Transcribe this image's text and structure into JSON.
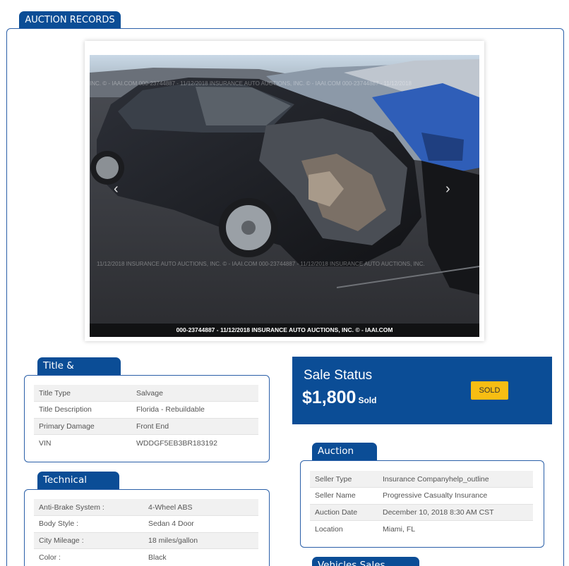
{
  "header": {
    "title": "AUCTION RECORDS"
  },
  "photo": {
    "caption": "000-23744887 - 11/12/2018 INSURANCE AUTO AUCTIONS, INC. © - IAAI.COM",
    "watermark_top": "INC. © - IAAI.COM      000-23744887 - 11/12/2018 INSURANCE AUTO AUCTIONS, INC. © - IAAI.COM      000-23744887 - 11/12/2018",
    "watermark_bottom": "11/12/2018 INSURANCE AUTO AUCTIONS, INC. © - IAAI.COM      000-23744887 - 11/12/2018 INSURANCE AUTO AUCTIONS, INC.",
    "prev_icon": "chevron-left",
    "next_icon": "chevron-right"
  },
  "title_condition": {
    "heading": "Title & Condition",
    "rows": [
      {
        "label": "Title Type",
        "value": "Salvage"
      },
      {
        "label": "Title Description",
        "value": "Florida - Rebuildable"
      },
      {
        "label": "Primary Damage",
        "value": "Front End"
      },
      {
        "label": "VIN",
        "value": "WDDGF5EB3BR183192"
      }
    ]
  },
  "technical_specs": {
    "heading": "Technical Specs",
    "rows": [
      {
        "label": "Anti-Brake System :",
        "value": "4-Wheel ABS"
      },
      {
        "label": "Body Style :",
        "value": "Sedan 4 Door"
      },
      {
        "label": "City Mileage :",
        "value": "18 miles/gallon"
      },
      {
        "label": "Color :",
        "value": "Black"
      }
    ]
  },
  "sale_status": {
    "heading": "Sale Status",
    "price": "$1,800",
    "price_suffix": "Sold",
    "badge": "SOLD"
  },
  "auction_info": {
    "heading": "Auction Info",
    "rows": [
      {
        "label": "Seller Type",
        "value": "Insurance Companyhelp_outline"
      },
      {
        "label": "Seller Name",
        "value": "Progressive Casualty Insurance"
      },
      {
        "label": "Auction Date",
        "value": "December 10, 2018 8:30 AM CST"
      },
      {
        "label": "Location",
        "value": "Miami, FL"
      }
    ]
  },
  "sales_history": {
    "heading": "Vehicles Sales History"
  },
  "colors": {
    "brand_blue": "#0b4d96",
    "badge_yellow": "#f7bd13"
  }
}
